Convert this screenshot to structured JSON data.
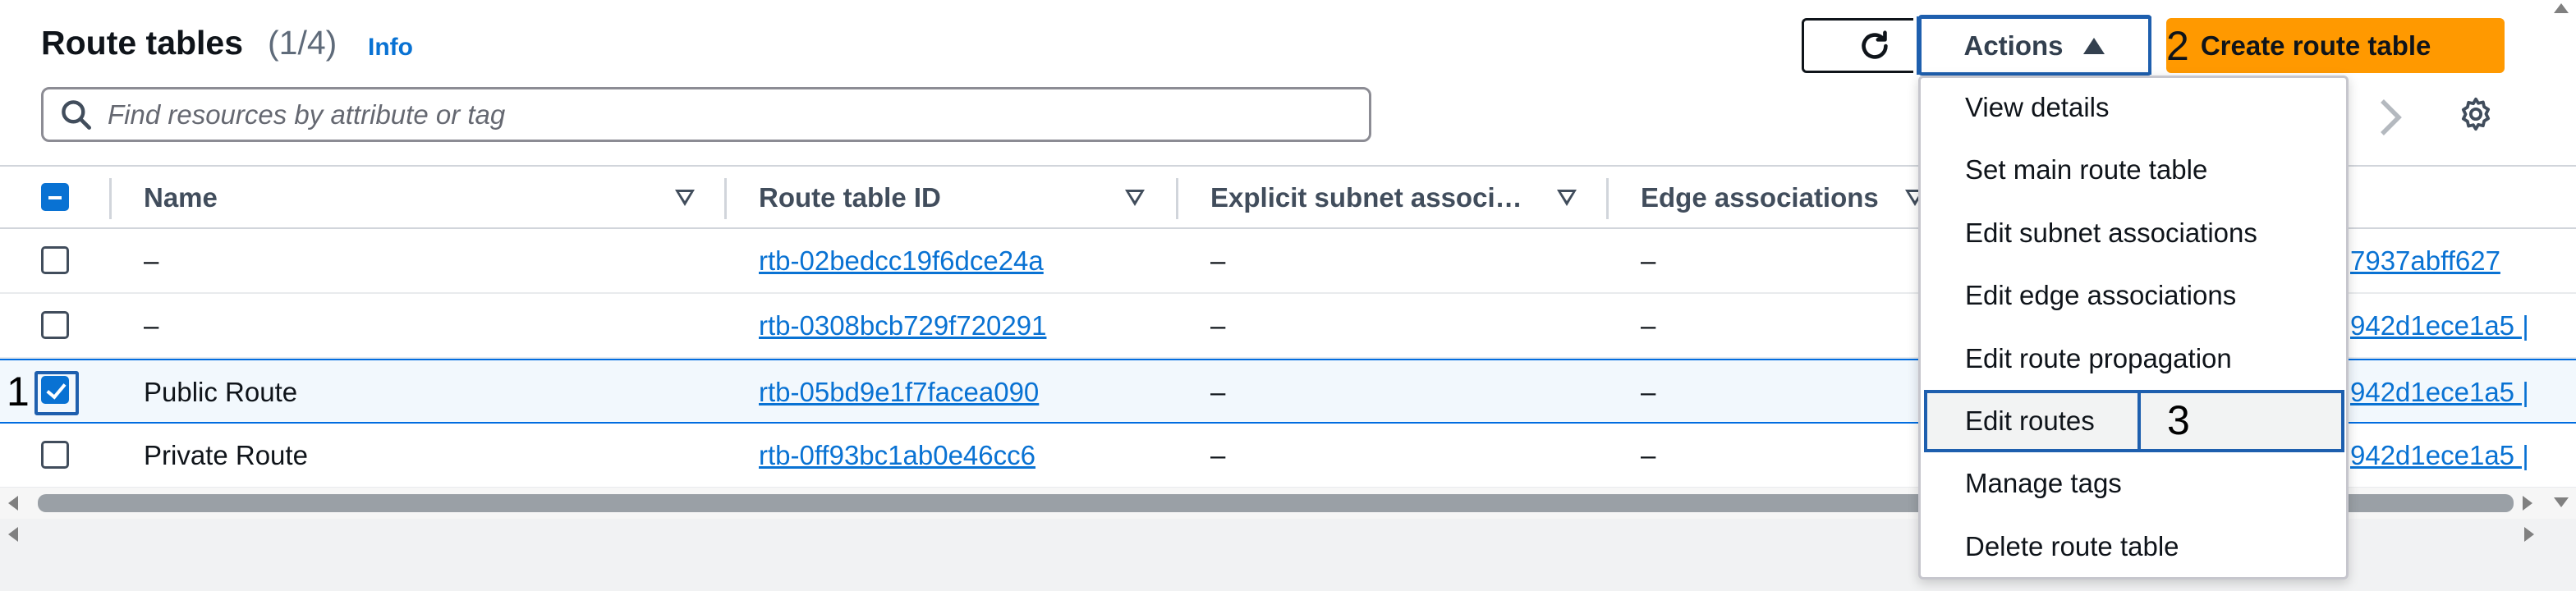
{
  "header": {
    "title": "Route tables",
    "count": "(1/4)",
    "info_link": "Info",
    "actions_label": "Actions",
    "create_label": "Create route table",
    "create_step": "2"
  },
  "search": {
    "placeholder": "Find resources by attribute or tag"
  },
  "table": {
    "columns": [
      "Name",
      "Route table ID",
      "Explicit subnet associ…",
      "Edge associations"
    ],
    "rows": [
      {
        "name": "–",
        "id": "rtb-02bedcc19f6dce24a",
        "subnet": "–",
        "edge": "–",
        "trailing": "7937abff627",
        "checked": false
      },
      {
        "name": "–",
        "id": "rtb-0308bcb729f720291",
        "subnet": "–",
        "edge": "–",
        "trailing": "942d1ece1a5 |",
        "checked": false
      },
      {
        "name": "Public Route",
        "id": "rtb-05bd9e1f7facea090",
        "subnet": "–",
        "edge": "–",
        "trailing": "942d1ece1a5 |",
        "checked": true
      },
      {
        "name": "Private Route",
        "id": "rtb-0ff93bc1ab0e46cc6",
        "subnet": "–",
        "edge": "–",
        "trailing": "942d1ece1a5 |",
        "checked": false
      }
    ]
  },
  "annotations": {
    "step1": "1",
    "step3": "3"
  },
  "menu": {
    "items": [
      "View details",
      "Set main route table",
      "Edit subnet associations",
      "Edit edge associations",
      "Edit route propagation",
      "Edit routes",
      "Manage tags",
      "Delete route table"
    ],
    "highlighted": "Edit routes"
  },
  "colors": {
    "accent": "#0972d3",
    "primary_button": "#ff9900",
    "annotation_outline": "#1e5fae"
  }
}
